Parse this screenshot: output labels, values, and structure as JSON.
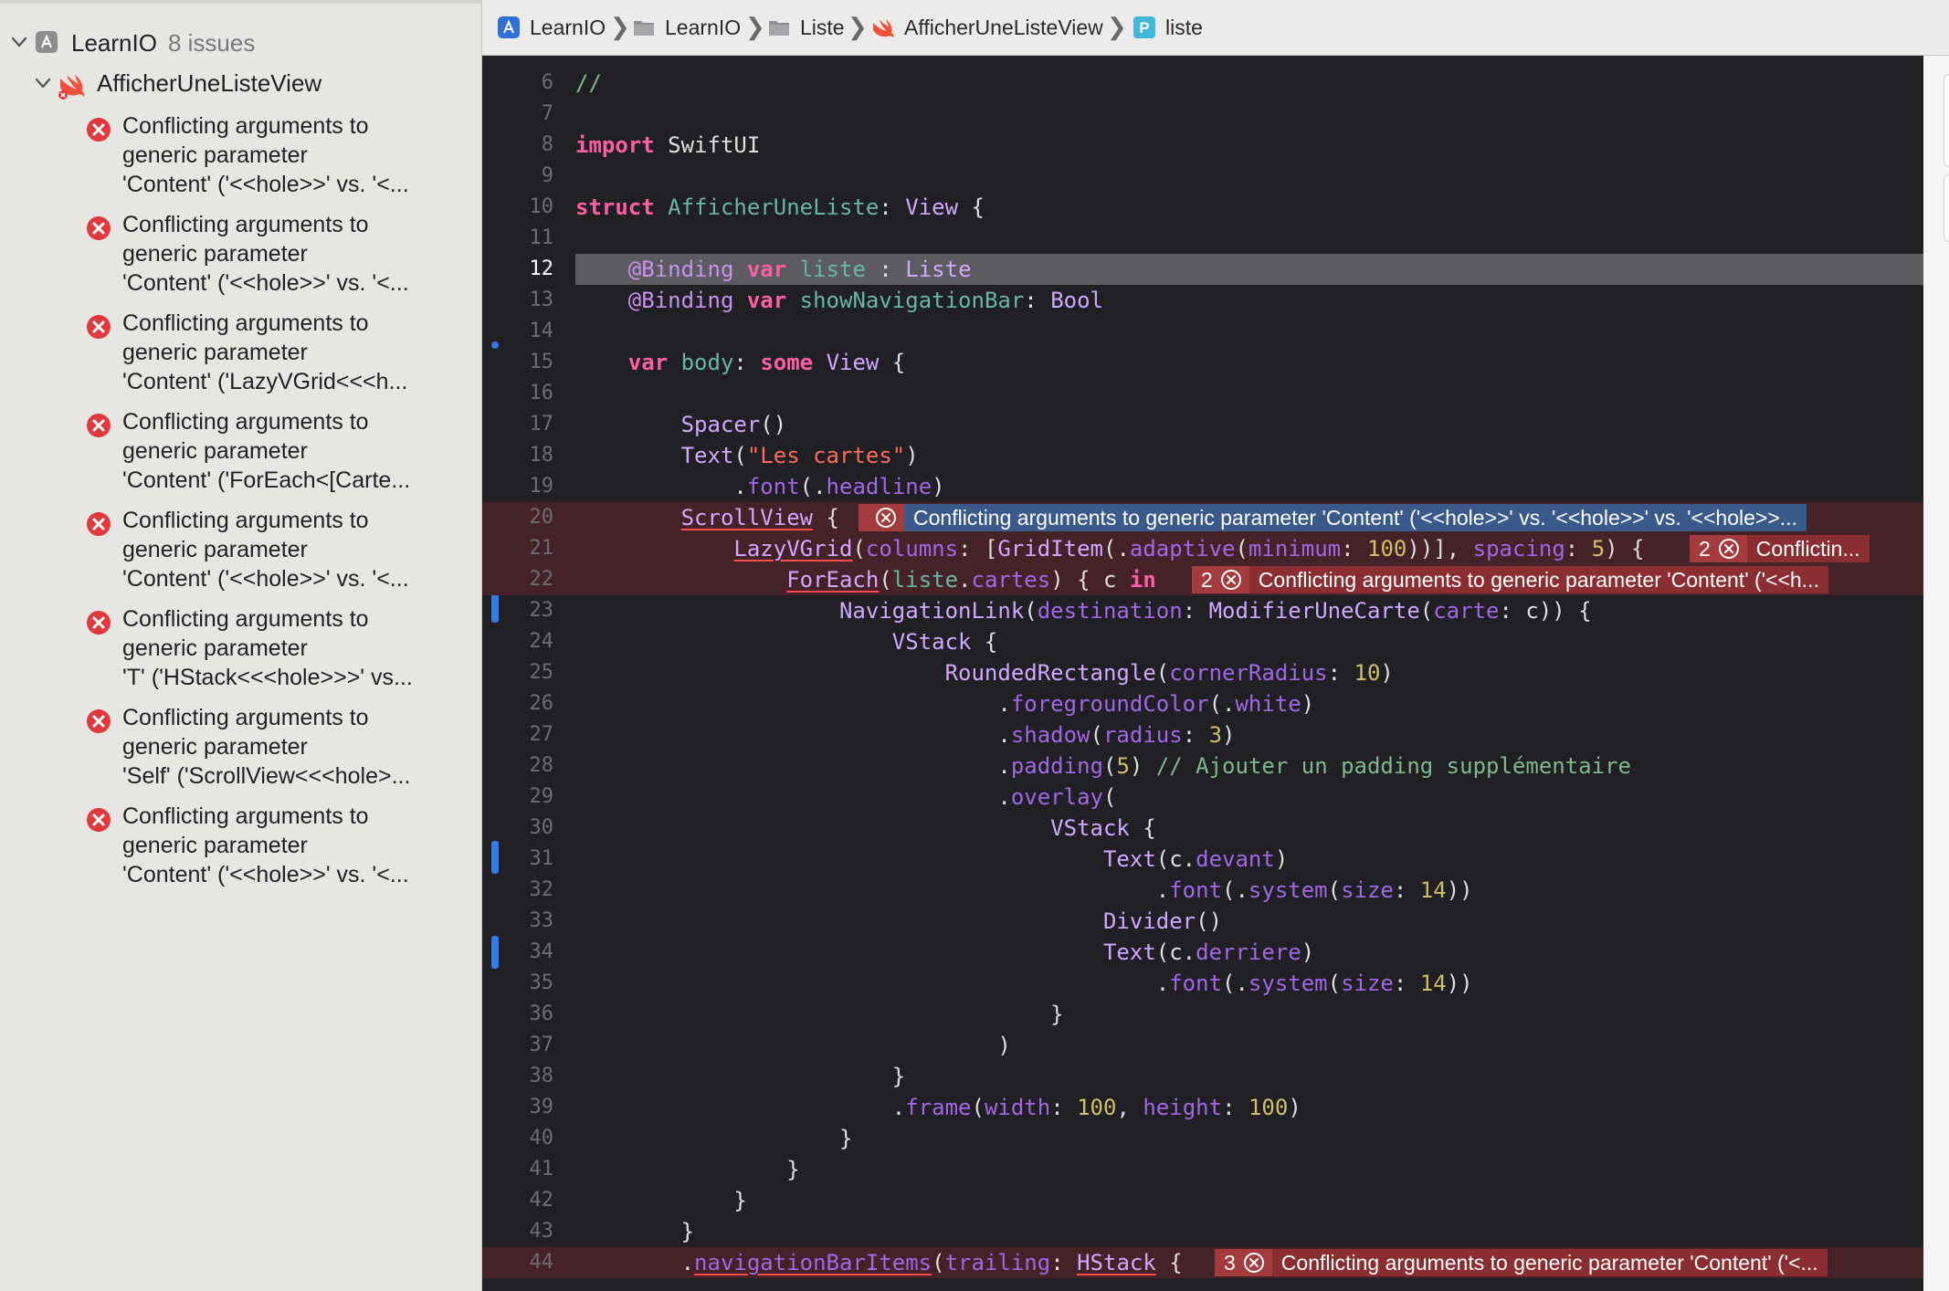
{
  "sidebar": {
    "project": {
      "name": "LearnIO",
      "issue_count": "8 issues"
    },
    "file": {
      "name": "AfficherUneListeView"
    },
    "issues": [
      {
        "lines": [
          "Conflicting arguments to",
          "generic parameter",
          "'Content' ('<<hole>>' vs. '<..."
        ]
      },
      {
        "lines": [
          "Conflicting arguments to",
          "generic parameter",
          "'Content' ('<<hole>>' vs. '<..."
        ]
      },
      {
        "lines": [
          "Conflicting arguments to",
          "generic parameter",
          "'Content' ('LazyVGrid<<<h..."
        ]
      },
      {
        "lines": [
          "Conflicting arguments to",
          "generic parameter",
          "'Content' ('ForEach<[Carte..."
        ]
      },
      {
        "lines": [
          "Conflicting arguments to",
          "generic parameter",
          "'Content' ('<<hole>>' vs. '<..."
        ]
      },
      {
        "lines": [
          "Conflicting arguments to",
          "generic parameter",
          "'T' ('HStack<<<hole>>>' vs..."
        ]
      },
      {
        "lines": [
          "Conflicting arguments to",
          "generic parameter",
          "'Self' ('ScrollView<<<hole>..."
        ]
      },
      {
        "lines": [
          "Conflicting arguments to",
          "generic parameter",
          "'Content' ('<<hole>>' vs. '<..."
        ]
      }
    ]
  },
  "breadcrumb": [
    {
      "label": "LearnIO",
      "icon": "app-icon"
    },
    {
      "label": "LearnIO",
      "icon": "folder-icon"
    },
    {
      "label": "Liste",
      "icon": "folder-icon"
    },
    {
      "label": "AfficherUneListeView",
      "icon": "swift-icon"
    },
    {
      "label": "liste",
      "icon": "property-icon"
    }
  ],
  "editor": {
    "current_line": 12,
    "lines": [
      {
        "num": "6",
        "html": "<span class=\"cm\">//</span>"
      },
      {
        "num": "7",
        "html": ""
      },
      {
        "num": "8",
        "html": "<span class=\"k\">import</span> SwiftUI"
      },
      {
        "num": "9",
        "html": ""
      },
      {
        "num": "10",
        "html": "<span class=\"k\">struct</span> <span class=\"v\">AfficherUneListe</span>: <span class=\"t\">View</span> {"
      },
      {
        "num": "11",
        "html": ""
      },
      {
        "num": "12",
        "html": "    <span class=\"attr\">@Binding</span> <span class=\"k\">var</span> <span class=\"v\">liste</span> : <span class=\"t\">Liste</span>",
        "current": true
      },
      {
        "num": "13",
        "html": "    <span class=\"attr\">@Binding</span> <span class=\"k\">var</span> <span class=\"v\">showNavigationBar</span>: <span class=\"t\">Bool</span>"
      },
      {
        "num": "14",
        "html": ""
      },
      {
        "num": "15",
        "html": "    <span class=\"k\">var</span> <span class=\"v\">body</span>: <span class=\"k\">some</span> <span class=\"t\">View</span> {"
      },
      {
        "num": "16",
        "html": ""
      },
      {
        "num": "17",
        "html": "        <span class=\"t\">Spacer</span>()"
      },
      {
        "num": "18",
        "html": "        <span class=\"t\">Text</span>(<span class=\"s\">\"Les cartes\"</span>)"
      },
      {
        "num": "19",
        "html": "            .<span class=\"p\">font</span>(.<span class=\"p\">headline</span>)"
      },
      {
        "num": "20",
        "html": "        <span class=\"t u\">ScrollView</span> {",
        "error": true
      },
      {
        "num": "21",
        "html": "            <span class=\"t u\">LazyVGrid</span>(<span class=\"p\">columns</span>: [<span class=\"t\">GridItem</span>(.<span class=\"p\">adaptive</span>(<span class=\"p\">minimum</span>: <span class=\"n\">100</span>))], <span class=\"p\">spacing</span>: <span class=\"n\">5</span>) {",
        "error": true
      },
      {
        "num": "22",
        "html": "                <span class=\"t u\">ForEach</span>(<span class=\"v\">liste</span>.<span class=\"p\">cartes</span>) { c <span class=\"k\">in</span>",
        "error": true
      },
      {
        "num": "23",
        "html": "                    <span class=\"t\">NavigationLink</span>(<span class=\"p\">destination</span>: <span class=\"t\">ModifierUneCarte</span>(<span class=\"p\">carte</span>: c)) {"
      },
      {
        "num": "24",
        "html": "                        <span class=\"t\">VStack</span> {"
      },
      {
        "num": "25",
        "html": "                            <span class=\"t\">RoundedRectangle</span>(<span class=\"p\">cornerRadius</span>: <span class=\"n\">10</span>)"
      },
      {
        "num": "26",
        "html": "                                .<span class=\"p\">foregroundColor</span>(.<span class=\"p\">white</span>)"
      },
      {
        "num": "27",
        "html": "                                .<span class=\"p\">shadow</span>(<span class=\"p\">radius</span>: <span class=\"n\">3</span>)"
      },
      {
        "num": "28",
        "html": "                                .<span class=\"p\">padding</span>(<span class=\"n\">5</span>) <span class=\"cm\">// Ajouter un padding supplémentaire</span>"
      },
      {
        "num": "29",
        "html": "                                .<span class=\"p\">overlay</span>("
      },
      {
        "num": "30",
        "html": "                                    <span class=\"t\">VStack</span> {"
      },
      {
        "num": "31",
        "html": "                                        <span class=\"t\">Text</span>(c.<span class=\"p\">devant</span>)"
      },
      {
        "num": "32",
        "html": "                                            .<span class=\"p\">font</span>(.<span class=\"p\">system</span>(<span class=\"p\">size</span>: <span class=\"n\">14</span>))"
      },
      {
        "num": "33",
        "html": "                                        <span class=\"t\">Divider</span>()"
      },
      {
        "num": "34",
        "html": "                                        <span class=\"t\">Text</span>(c.<span class=\"p\">derriere</span>)"
      },
      {
        "num": "35",
        "html": "                                            .<span class=\"p\">font</span>(.<span class=\"p\">system</span>(<span class=\"p\">size</span>: <span class=\"n\">14</span>))"
      },
      {
        "num": "36",
        "html": "                                    }"
      },
      {
        "num": "37",
        "html": "                                )"
      },
      {
        "num": "38",
        "html": "                        }"
      },
      {
        "num": "39",
        "html": "                        .<span class=\"p\">frame</span>(<span class=\"p\">width</span>: <span class=\"n\">100</span>, <span class=\"p\">height</span>: <span class=\"n\">100</span>)"
      },
      {
        "num": "40",
        "html": "                    }"
      },
      {
        "num": "41",
        "html": "                }"
      },
      {
        "num": "42",
        "html": "            }"
      },
      {
        "num": "43",
        "html": "        }"
      },
      {
        "num": "44",
        "html": "        .<span class=\"p u\">navigationBarItems</span>(<span class=\"p\">trailing</span>: <span class=\"t u\">HStack</span> {",
        "error": true
      }
    ],
    "annotations": [
      {
        "line": "20",
        "count": "",
        "message": "Conflicting arguments to generic parameter 'Content' ('<<hole>>' vs. '<<hole>>' vs. '<<hole>>...",
        "selected": true
      },
      {
        "line": "21",
        "count": "2",
        "message": "Conflictin..."
      },
      {
        "line": "22",
        "count": "2",
        "message": "Conflicting arguments to generic parameter 'Content' ('<<h..."
      },
      {
        "line": "44",
        "count": "3",
        "message": "Conflicting arguments to generic parameter 'Content' ('<..."
      }
    ]
  },
  "colors": {
    "editor_bg": "#1f1f24",
    "error_line_bg": "#452228",
    "error_badge": "#8a2e32",
    "selected_annotation": "#3b5a8c",
    "change_bar": "#2f7be8",
    "error_icon": "#e0393e"
  }
}
